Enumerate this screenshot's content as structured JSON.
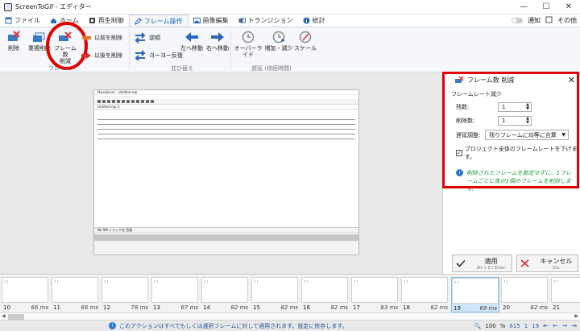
{
  "window": {
    "title": "ScreenToGif - エディター",
    "controls": [
      "—",
      "☐",
      "✕"
    ]
  },
  "tabs": [
    {
      "label": "ファイル"
    },
    {
      "label": "ホーム"
    },
    {
      "label": "再生制御"
    },
    {
      "label": "フレーム操作"
    },
    {
      "label": "画像編集"
    },
    {
      "label": "トランジション"
    },
    {
      "label": "統計"
    }
  ],
  "tabbar_right": {
    "notifications": "通知",
    "other": "その他"
  },
  "ribbon": {
    "delete": "削除",
    "delete_duplicates": "重複削除",
    "reduce_frames_1": "フレーム数",
    "reduce_frames_2": "削減",
    "delete_previous": "以前を削除",
    "delete_next": "以後を削除",
    "reverse": "逆順",
    "yoyo": "ヨーヨー反復",
    "move_left": "左へ移動",
    "move_right": "右へ移動",
    "override": "オーバーライド",
    "increase_decrease": "増加・減少",
    "scale": "スケール",
    "group_frames": "フレーム",
    "group_reorder": "並び替え",
    "group_delay": "遅延 (待続時間)"
  },
  "panel": {
    "title": "フレーム数 削減",
    "section": "フレームレート減少",
    "keep_label": "残数:",
    "keep_value": "1",
    "remove_label": "削除数:",
    "remove_value": "1",
    "delay_label": "遅延調整:",
    "delay_option": "残りフレームに均等に合算",
    "checkbox_label": "プロジェクト全体のフレームレートを下げます。",
    "checkbox_checked": true,
    "hint": "削除されたフレームを勘定せずに、1フレームごとに後の1個のフレームを削除します。"
  },
  "buttons": {
    "apply": "適用",
    "apply_shortcut": "Alt + E / Enter",
    "cancel": "キャンセル",
    "cancel_shortcut": "Esc"
  },
  "preview": {
    "app_title": "MuseScore - Untitled.mp",
    "tab_label": "Untitled.mp 3",
    "panel_header_1": "No",
    "panel_header_2": "SM",
    "panel_header_3": "トラック名",
    "panel_header_4": "音量"
  },
  "frames": [
    {
      "index": "10",
      "delay": "66 ms"
    },
    {
      "index": "11",
      "delay": "66 ms"
    },
    {
      "index": "12",
      "delay": "78 ms"
    },
    {
      "index": "13",
      "delay": "67 ms"
    },
    {
      "index": "14",
      "delay": "82 ms"
    },
    {
      "index": "15",
      "delay": "82 ms"
    },
    {
      "index": "16",
      "delay": "82 ms"
    },
    {
      "index": "17",
      "delay": "83 ms"
    },
    {
      "index": "18",
      "delay": "82 ms"
    },
    {
      "index": "19",
      "delay": "69 ms"
    },
    {
      "index": "20",
      "delay": "82 ms"
    },
    {
      "index": "21",
      "delay": "82 ms"
    }
  ],
  "selected_frame": "19",
  "status": {
    "message": "このアクションはすべてもしくは選択フレームに対して適用されます。設定に依存します。",
    "zoom": "100",
    "zoom_unit": "%",
    "frame_count": "615",
    "current": "1",
    "selected": "19"
  },
  "colors": {
    "accent": "#1d5fa8",
    "highlight": "#e00000",
    "hint": "#2a9a4a"
  }
}
